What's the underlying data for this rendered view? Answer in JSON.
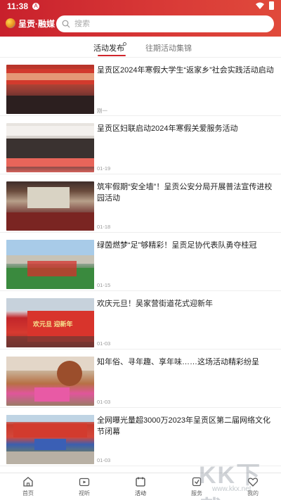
{
  "status": {
    "time": "11:38",
    "notice_icon": "A"
  },
  "header": {
    "logo_text": "呈贡·融媒",
    "search_placeholder": "搜索"
  },
  "tabs": [
    {
      "label": "活动发布",
      "active": true
    },
    {
      "label": "往期活动集锦",
      "active": false
    }
  ],
  "news": [
    {
      "title": "呈贡区2024年寒假大学生“返家乡”社会实践活动启动",
      "date": "刚一"
    },
    {
      "title": "呈贡区妇联启动2024年寒假关爱服务活动",
      "date": "01-19"
    },
    {
      "title": "筑牢假期“安全墙”！呈贡公安分局开展普法宣传进校园活动",
      "date": "01-18"
    },
    {
      "title": "绿茵燃梦“足”够精彩！呈贡足协代表队勇夺桂冠",
      "date": "01-15"
    },
    {
      "title": "欢庆元旦！吴家营街道花式迎新年",
      "date": "01-03"
    },
    {
      "title": "知年俗、寻年趣、享年味……这场活动精彩纷呈",
      "date": "01-03"
    },
    {
      "title": "全网曝光量超3000万2023年呈贡区第二届网络文化节闭幕",
      "date": "01-03"
    }
  ],
  "thumb_text": {
    "t5_banner": "欢元旦 迎新年"
  },
  "bottom_nav": [
    {
      "label": "首页",
      "icon": "home-icon",
      "active": false
    },
    {
      "label": "视听",
      "icon": "tv-icon",
      "active": false
    },
    {
      "label": "活动",
      "icon": "activity-icon",
      "active": true
    },
    {
      "label": "服务",
      "icon": "service-icon",
      "active": false
    },
    {
      "label": "我的",
      "icon": "heart-icon",
      "active": false
    }
  ],
  "watermark": {
    "main": "KK下载",
    "sub": "www.kkx.net"
  },
  "colors": {
    "brand_red": "#c8202c",
    "tab_underline": "#d1262c"
  }
}
